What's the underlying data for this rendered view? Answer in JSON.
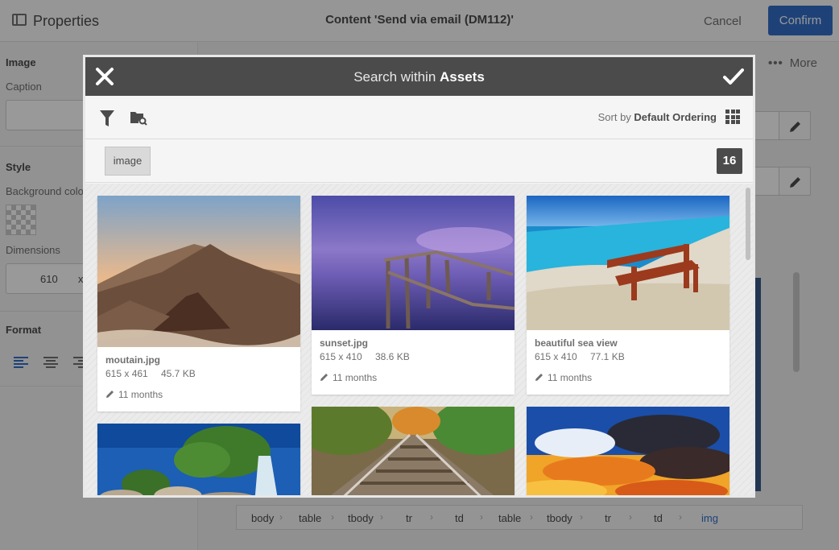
{
  "editor": {
    "properties_title": "Properties",
    "content_title": "Content 'Send via email (DM112)'",
    "cancel_label": "Cancel",
    "confirm_label": "Confirm",
    "more_label": "More"
  },
  "sidebar": {
    "image_heading": "Image",
    "caption_label": "Caption",
    "style_heading": "Style",
    "bg_color_label": "Background color",
    "dimensions_label": "Dimensions",
    "width_value": "610",
    "dims_separator": "x",
    "format_heading": "Format"
  },
  "breadcrumbs": [
    "body",
    "table",
    "tbody",
    "tr",
    "td",
    "table",
    "tbody",
    "tr",
    "td",
    "img"
  ],
  "modal": {
    "title_prefix": "Search within",
    "title_bold": "Assets",
    "sort_prefix": "Sort by",
    "sort_value": "Default Ordering",
    "tag": "image",
    "result_count": "16"
  },
  "assets": [
    {
      "name": "moutain.jpg",
      "dims": "615 x 461",
      "size": "45.7 KB",
      "modified": "11 months",
      "theme": "mountain"
    },
    {
      "name": "sunset.jpg",
      "dims": "615 x 410",
      "size": "38.6 KB",
      "modified": "11 months",
      "theme": "pier"
    },
    {
      "name": "beautiful sea view",
      "dims": "615 x 410",
      "size": "77.1 KB",
      "modified": "11 months",
      "theme": "bench"
    },
    {
      "name": "",
      "dims": "",
      "size": "",
      "modified": "",
      "theme": "waterfall"
    },
    {
      "name": "",
      "dims": "",
      "size": "",
      "modified": "",
      "theme": "railway"
    },
    {
      "name": "",
      "dims": "",
      "size": "",
      "modified": "",
      "theme": "clouds"
    }
  ],
  "colors": {
    "accent": "#326ec8",
    "modal_header": "#4b4b4b"
  }
}
